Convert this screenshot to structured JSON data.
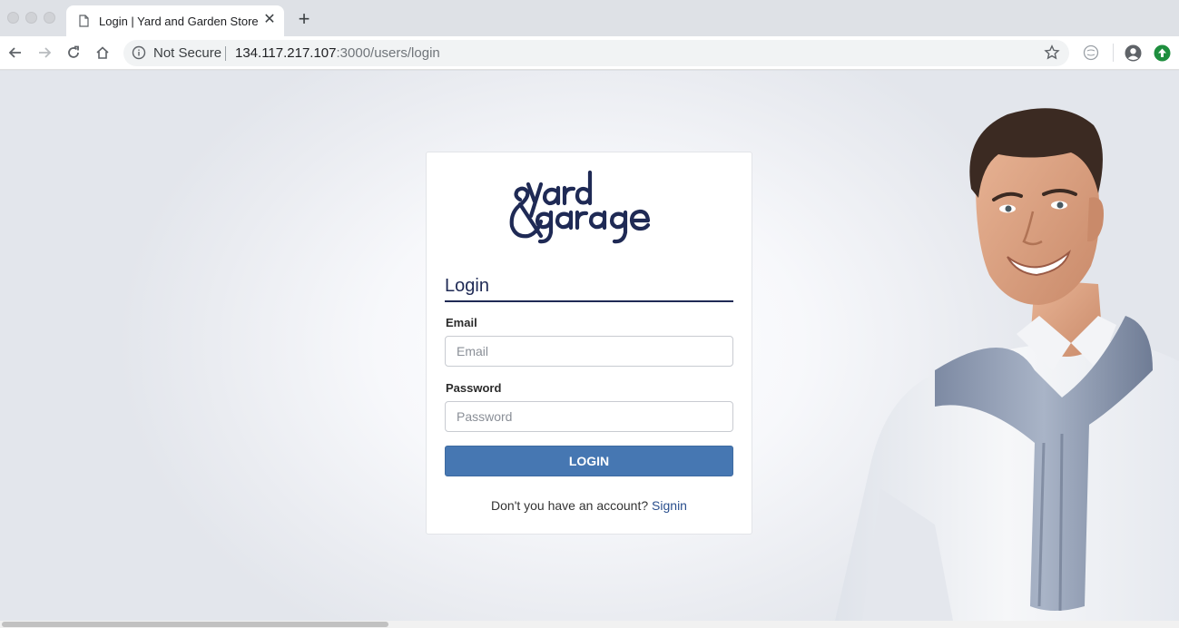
{
  "browser": {
    "tab": {
      "title": "Login | Yard and Garden Store",
      "close": "✕"
    },
    "new_tab": "+",
    "security_label": "Not Secure",
    "url": {
      "host": "134.117.217.107",
      "rest": ":3000/users/login"
    },
    "icons": [
      "back-icon",
      "forward-icon",
      "reload-icon",
      "home-icon",
      "info-icon",
      "star-icon",
      "extension-icon",
      "account-icon",
      "update-icon"
    ]
  },
  "brand": {
    "logo_text": "&yard garage",
    "color": "#1f2a55"
  },
  "login": {
    "heading": "Login",
    "email_label": "Email",
    "email_placeholder": "Email",
    "password_label": "Password",
    "password_placeholder": "Password",
    "button": "LOGIN",
    "signup_text": "Don't you have an account? ",
    "signup_link": "Signin"
  },
  "colors": {
    "accent": "#4677b2",
    "link": "#2a4f8d"
  }
}
